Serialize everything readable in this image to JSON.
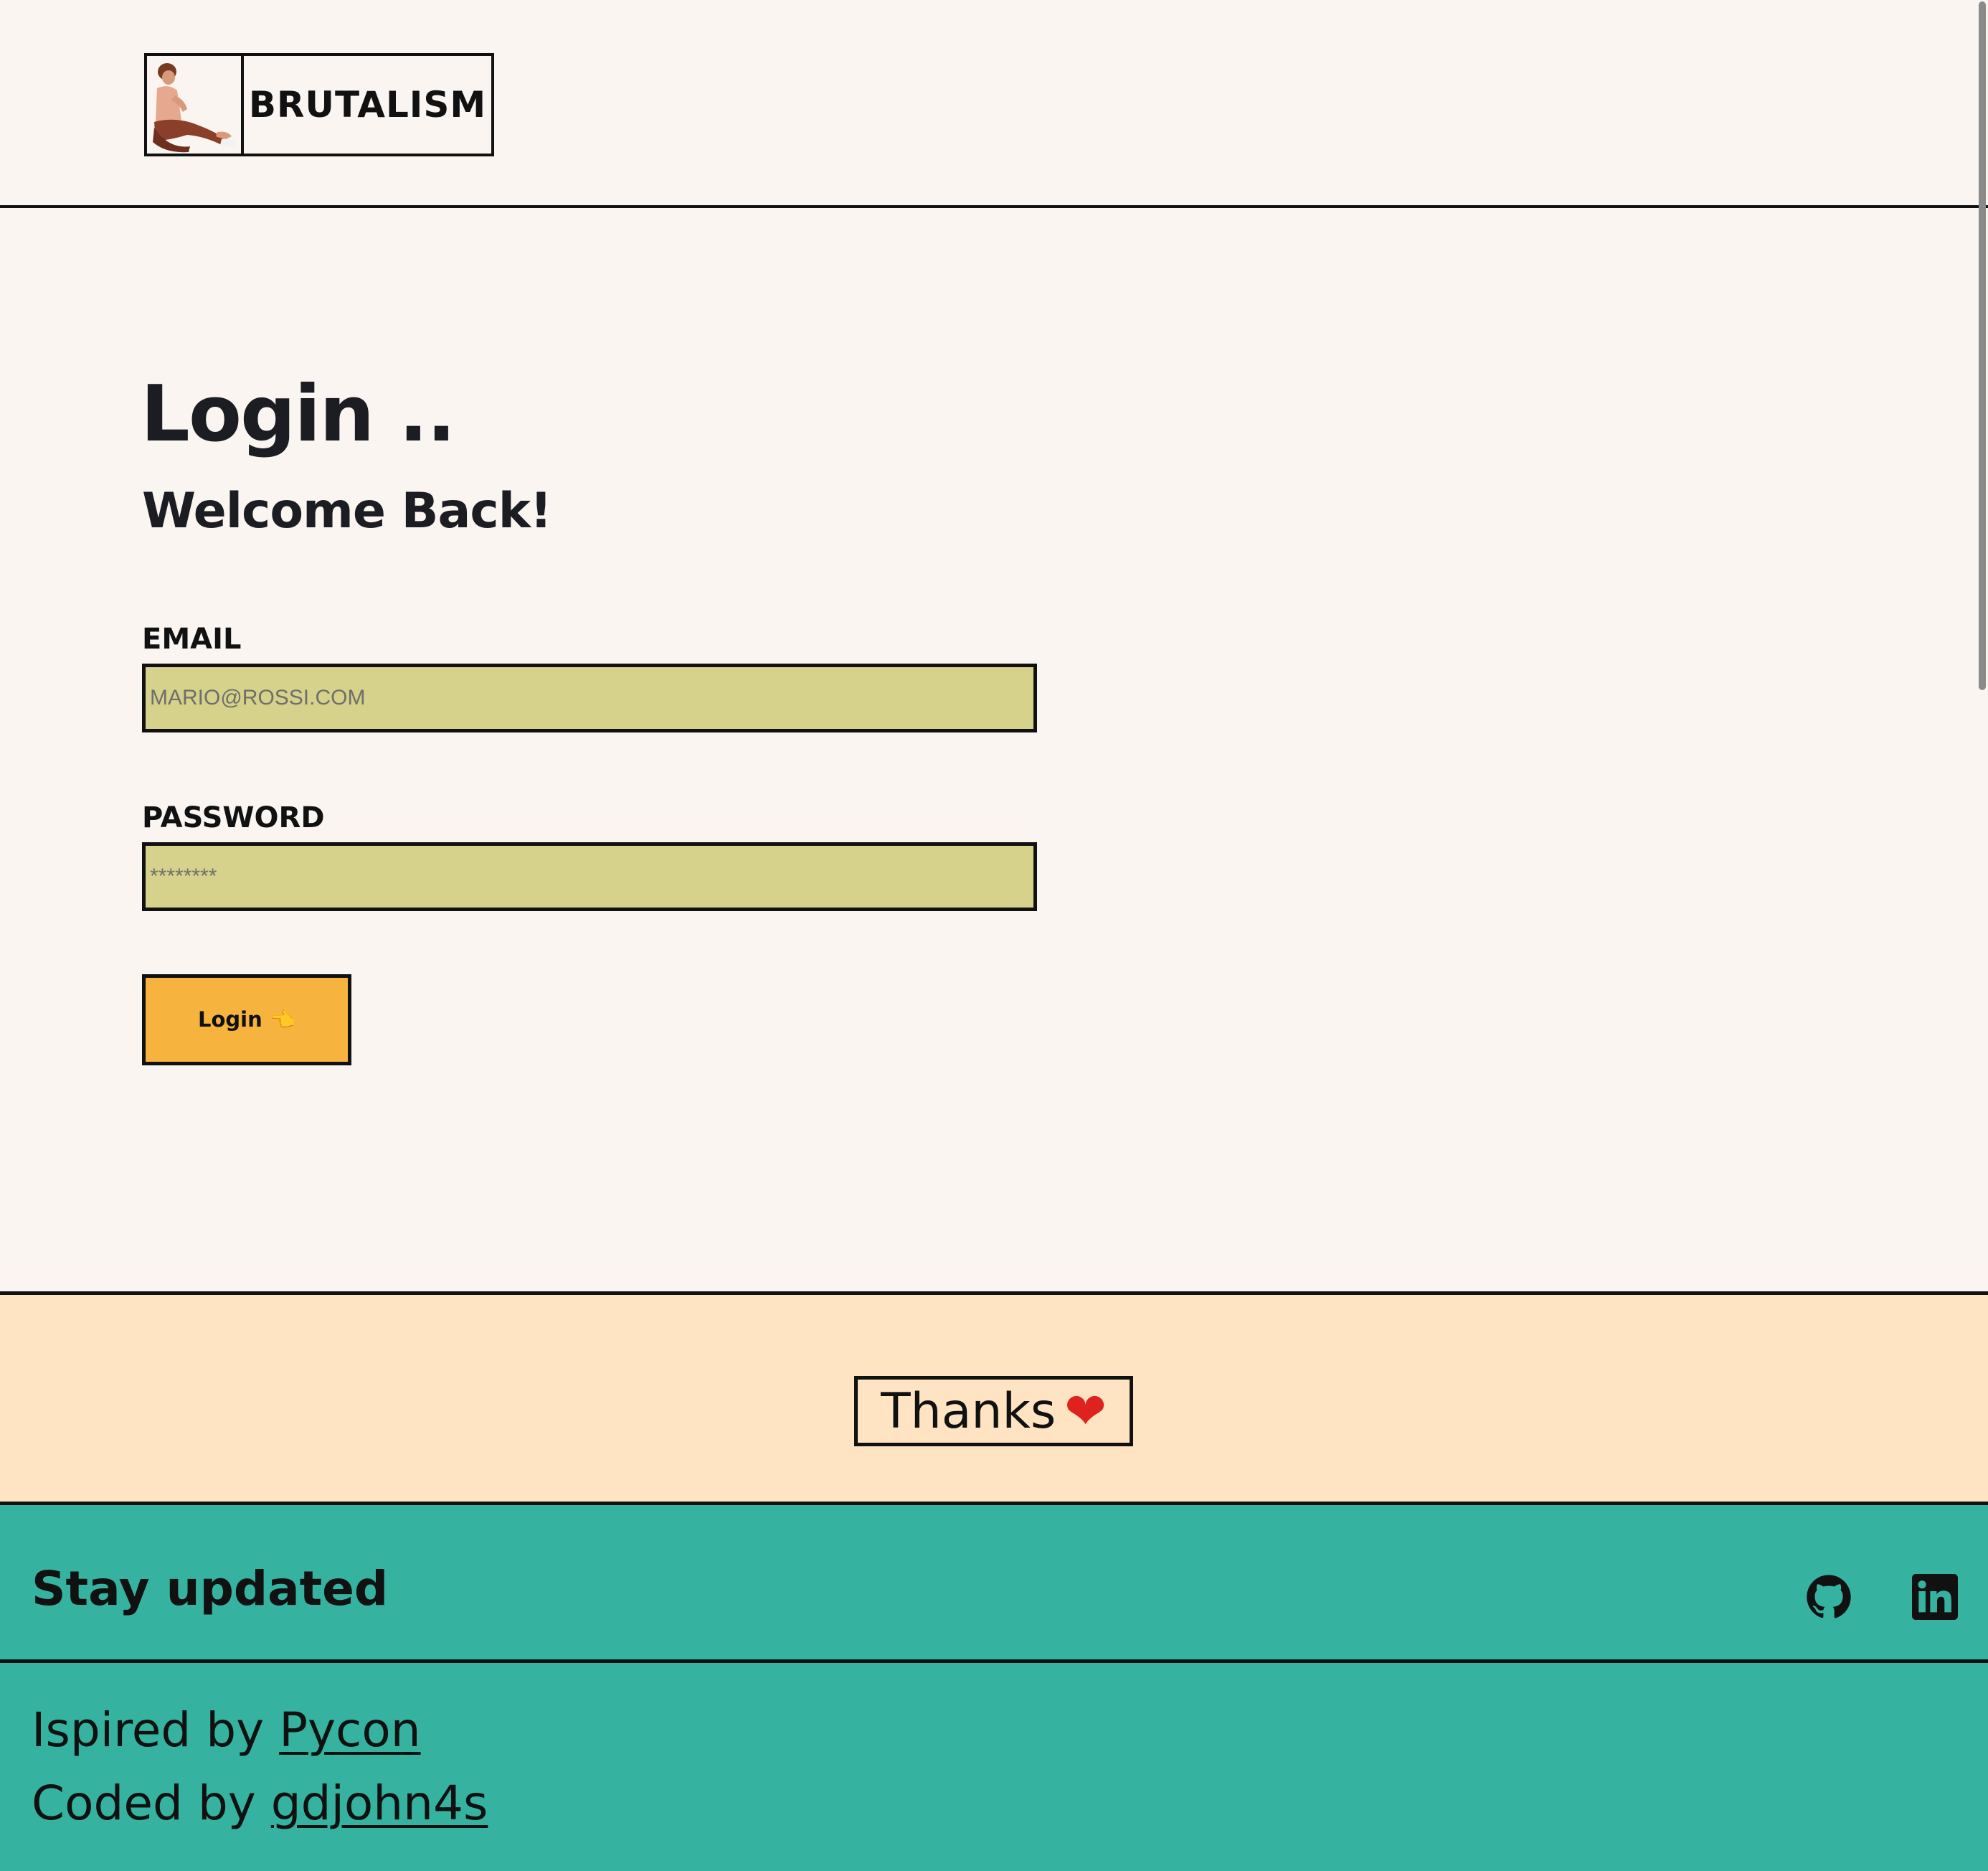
{
  "header": {
    "logo_text": "BRUTALISM"
  },
  "main": {
    "title": "Login ..",
    "subtitle": "Welcome Back!",
    "email_label": "EMAIL",
    "email_placeholder": "MARIO@ROSSI.COM",
    "password_label": "PASSWORD",
    "password_placeholder": "********",
    "login_button": "Login 👈"
  },
  "thanks": {
    "text": "Thanks",
    "heart": "❤"
  },
  "footer": {
    "stay_updated": "Stay updated",
    "social_icons": [
      "github-icon",
      "linkedin-icon"
    ],
    "inspired_prefix": "Ispired by ",
    "inspired_link": "Pycon",
    "coded_prefix": "Coded by ",
    "coded_link": "gdjohn4s"
  },
  "colors": {
    "background": "#fbf5f2",
    "input_fill": "#d6d28c",
    "button_fill": "#f6b33e",
    "thanks_band": "#ffe4c4",
    "footer": "#35b3a0"
  }
}
